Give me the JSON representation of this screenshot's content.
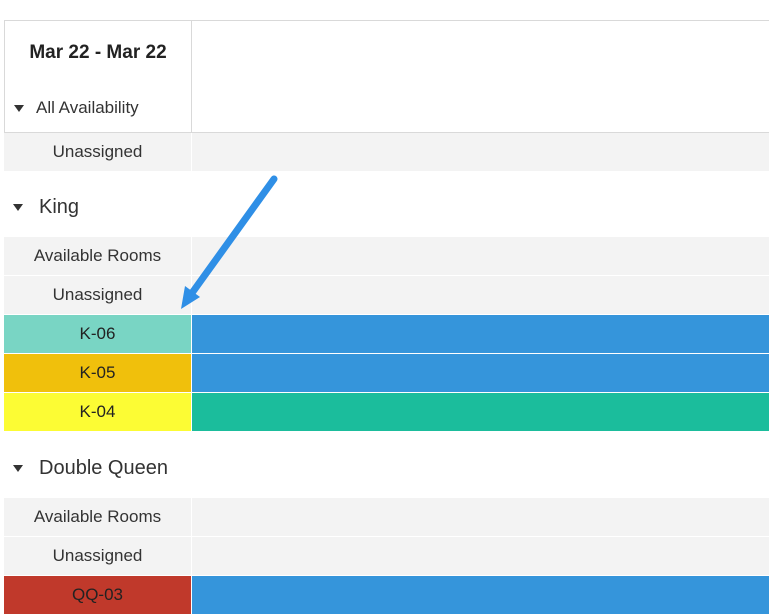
{
  "header": {
    "date_range": "Mar 22 - Mar 22"
  },
  "all_availability": {
    "label": "All Availability"
  },
  "top_unassigned": {
    "label": "Unassigned"
  },
  "groups": [
    {
      "name": "King",
      "available_rooms_label": "Available Rooms",
      "unassigned_label": "Unassigned",
      "rooms": [
        {
          "name": "K-06",
          "label_color": "#79d5c4",
          "bar_color": "#3595db"
        },
        {
          "name": "K-05",
          "label_color": "#f0c00c",
          "bar_color": "#3595db"
        },
        {
          "name": "K-04",
          "label_color": "#fcfc34",
          "bar_color": "#1bbd9c"
        }
      ]
    },
    {
      "name": "Double Queen",
      "available_rooms_label": "Available Rooms",
      "unassigned_label": "Unassigned",
      "rooms": [
        {
          "name": "QQ-03",
          "label_color": "#c0392b",
          "bar_color": "#3595db"
        }
      ]
    }
  ],
  "annotation": {
    "arrow_color": "#2f8fe6"
  }
}
